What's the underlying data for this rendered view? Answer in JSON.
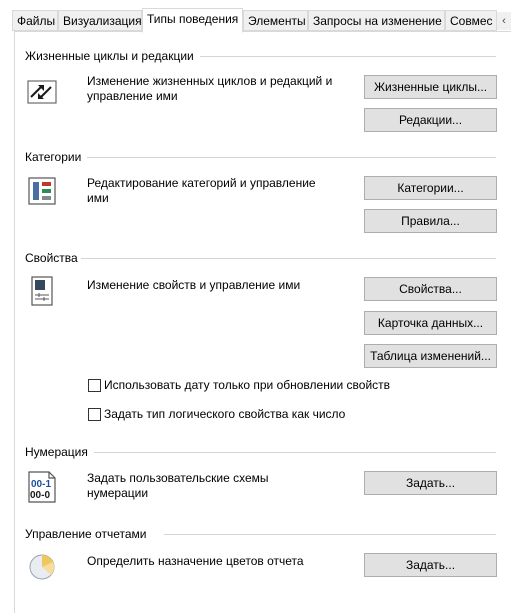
{
  "tabs": [
    {
      "label": "Файлы"
    },
    {
      "label": "Визуализация"
    },
    {
      "label": "Типы поведения"
    },
    {
      "label": "Элементы"
    },
    {
      "label": "Запросы на изменение"
    },
    {
      "label": "Совмес"
    }
  ],
  "tab_scroll_glyph": "‹",
  "sections": {
    "lifecycle": {
      "title": "Жизненные циклы и редакции",
      "description": "Изменение жизненных циклов и редакций и управление ими",
      "buttons": [
        "Жизненные циклы...",
        "Редакции..."
      ]
    },
    "categories": {
      "title": "Категории",
      "description": "Редактирование категорий и управление ими",
      "buttons": [
        "Категории...",
        "Правила..."
      ]
    },
    "properties": {
      "title": "Свойства",
      "description": "Изменение свойств и управление ими",
      "buttons": [
        "Свойства...",
        "Карточка данных...",
        "Таблица изменений..."
      ],
      "checkboxes": [
        {
          "label": "Использовать дату только при обновлении свойств",
          "checked": false
        },
        {
          "label": "Задать тип логического свойства как число",
          "checked": false
        }
      ]
    },
    "numbering": {
      "title": "Нумерация",
      "description": "Задать пользовательские схемы нумерации",
      "buttons": [
        "Задать..."
      ],
      "icon_text_top": "00-1",
      "icon_text_bottom": "00-0"
    },
    "reports": {
      "title": "Управление отчетами",
      "description": "Определить назначение цветов отчета",
      "buttons": [
        "Задать..."
      ]
    }
  }
}
